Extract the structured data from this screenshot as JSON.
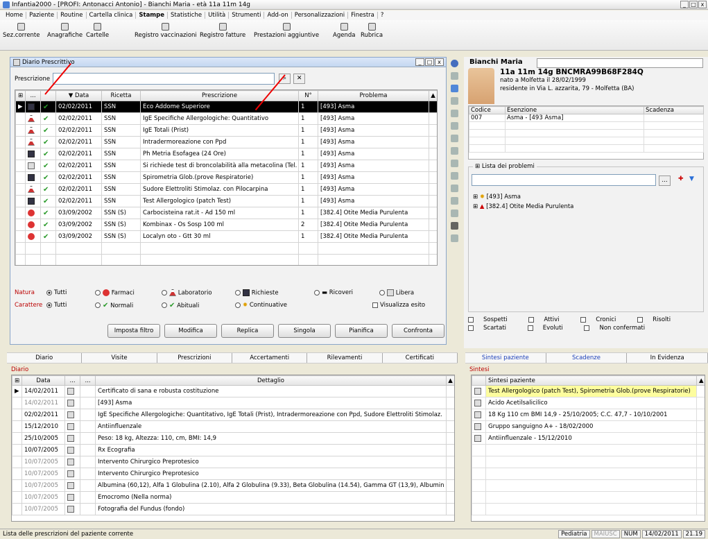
{
  "window": {
    "title": "Infantia2000 - [PROFI: Antonacci Antonio] - Bianchi Maria - età 11a 11m 14g"
  },
  "menu": [
    "Home",
    "Paziente",
    "Routine",
    "Cartella clinica",
    "Stampe",
    "Statistiche",
    "Utilità",
    "Strumenti",
    "Add-on",
    "Personalizzazioni",
    "Finestra",
    "?"
  ],
  "toolbar": [
    "Sez.corrente",
    "Anagrafiche",
    "Cartelle",
    "Registro vaccinazioni",
    "Registro fatture",
    "Prestazioni aggiuntive",
    "Agenda",
    "Rubrica"
  ],
  "dp": {
    "title": "Diario Prescrittivo",
    "presc_label": "Prescrizione",
    "headers": [
      "...",
      "Data",
      "Ricetta",
      "Prescrizione",
      "N°",
      "Problema"
    ],
    "rows": [
      {
        "type": "mon",
        "date": "02/02/2011",
        "ricetta": "SSN",
        "presc": "Eco Addome Superiore",
        "n": "1",
        "prob": "[493] Asma"
      },
      {
        "type": "flask",
        "date": "02/02/2011",
        "ricetta": "SSN",
        "presc": "IgE Specifiche Allergologiche: Quantitativo",
        "n": "1",
        "prob": "[493] Asma"
      },
      {
        "type": "flask",
        "date": "02/02/2011",
        "ricetta": "SSN",
        "presc": "IgE Totali (Prist)",
        "n": "1",
        "prob": "[493] Asma"
      },
      {
        "type": "flask",
        "date": "02/02/2011",
        "ricetta": "SSN",
        "presc": "Intradermoreazione con Ppd",
        "n": "1",
        "prob": "[493] Asma"
      },
      {
        "type": "mon",
        "date": "02/02/2011",
        "ricetta": "SSN",
        "presc": "Ph Metria Esofagea (24 Ore)",
        "n": "1",
        "prob": "[493] Asma"
      },
      {
        "type": "doc",
        "date": "02/02/2011",
        "ricetta": "SSN",
        "presc": "Si richiede test di broncolabilità alla metacolina (Tel.",
        "n": "1",
        "prob": "[493] Asma"
      },
      {
        "type": "mon",
        "date": "02/02/2011",
        "ricetta": "SSN",
        "presc": "Spirometria Glob.(prove Respiratorie)",
        "n": "1",
        "prob": "[493] Asma"
      },
      {
        "type": "flask",
        "date": "02/02/2011",
        "ricetta": "SSN",
        "presc": "Sudore Elettroliti Stimolaz. con Pilocarpina",
        "n": "1",
        "prob": "[493] Asma"
      },
      {
        "type": "mon",
        "date": "02/02/2011",
        "ricetta": "SSN",
        "presc": "Test Allergologico (patch Test)",
        "n": "1",
        "prob": "[493] Asma"
      },
      {
        "type": "pill",
        "date": "03/09/2002",
        "ricetta": "SSN (S)",
        "presc": "Carbocisteina rat.it - Ad 150 ml",
        "n": "1",
        "prob": "[382.4] Otite Media Purulenta"
      },
      {
        "type": "pill",
        "date": "03/09/2002",
        "ricetta": "SSN (S)",
        "presc": "Kombinax - Os Sosp 100 ml",
        "n": "2",
        "prob": "[382.4] Otite Media Purulenta"
      },
      {
        "type": "pill",
        "date": "03/09/2002",
        "ricetta": "SSN (S)",
        "presc": "Localyn oto - Gtt 30 ml",
        "n": "1",
        "prob": "[382.4] Otite Media Purulenta"
      }
    ],
    "natura_label": "Natura",
    "natura": [
      "Tutti",
      "Farmaci",
      "Laboratorio",
      "Richieste",
      "Ricoveri",
      "Libera"
    ],
    "carattere_label": "Carattere",
    "carattere": [
      "Tutti",
      "Normali",
      "Abituali",
      "Continuative"
    ],
    "visualizza": "Visualizza esito",
    "buttons": [
      "Imposta filtro",
      "Modifica",
      "Replica",
      "Singola",
      "Pianifica",
      "Confronta"
    ]
  },
  "patient": {
    "name": "Bianchi Maria",
    "line1": "11a 11m 14g  BNCMRA99B68F284Q",
    "line2": "nato a Molfetta il 28/02/1999",
    "line3": "residente in Via L. azzarita, 79 - Molfetta (BA)",
    "esenzione_headers": [
      "Codice",
      "Esenzione",
      "Scadenza"
    ],
    "esenzione": [
      {
        "codice": "007",
        "esenzione": "Asma - [493 Asma]",
        "scadenza": ""
      }
    ],
    "problems_title": "Lista dei problemi",
    "problems": [
      "[493] Asma",
      "[382.4] Otite Media Purulenta"
    ],
    "legend": [
      "Sospetti",
      "Attivi",
      "Cronici",
      "Risolti",
      "Scartati",
      "Evoluti",
      "Non confermati"
    ]
  },
  "tabs_left": [
    "Diario",
    "Visite",
    "Prescrizioni",
    "Accertamenti",
    "Rilevamenti",
    "Certificati"
  ],
  "tabs_right": [
    "Sintesi paziente",
    "Scadenze",
    "In Evidenza"
  ],
  "diario": {
    "label": "Diario",
    "headers": [
      "Data",
      "...",
      "...",
      "Dettaglio"
    ],
    "rows": [
      {
        "date": "14/02/2011",
        "dim": false,
        "text": "Certificato di sana e robusta costituzione"
      },
      {
        "date": "14/02/2011",
        "dim": true,
        "text": "[493] Asma"
      },
      {
        "date": "02/02/2011",
        "dim": false,
        "text": "IgE Specifiche Allergologiche: Quantitativo, IgE Totali (Prist), Intradermoreazione con Ppd, Sudore Elettroliti Stimolaz."
      },
      {
        "date": "15/12/2010",
        "dim": false,
        "text": "Antiinfluenzale"
      },
      {
        "date": "25/10/2005",
        "dim": false,
        "text": "Peso: 18 kg, Altezza: 110, cm, BMI: 14,9"
      },
      {
        "date": "10/07/2005",
        "dim": false,
        "text": "Rx Ecografia"
      },
      {
        "date": "10/07/2005",
        "dim": true,
        "text": "Intervento Chirurgico Preprotesico"
      },
      {
        "date": "10/07/2005",
        "dim": true,
        "text": "Intervento Chirurgico Preprotesico"
      },
      {
        "date": "10/07/2005",
        "dim": true,
        "text": "Albumina (60,12), Alfa 1 Globulina (2.10), Alfa 2 Globulina (9.33), Beta Globulina (14.54), Gamma GT (13,9), Albumin"
      },
      {
        "date": "10/07/2005",
        "dim": true,
        "text": "Emocromo (Nella norma)"
      },
      {
        "date": "10/07/2005",
        "dim": true,
        "text": "Fotografia del Fundus (fondo)"
      }
    ]
  },
  "sintesi": {
    "label": "Sintesi",
    "header": "Sintesi paziente",
    "rows": [
      "Test Allergologico (patch Test), Spirometria Glob.(prove Respiratorie)",
      "Acido Acetilsalicilico",
      "18 Kg 110 cm BMI 14,9 - 25/10/2005; C.C. 47,7 - 10/10/2001",
      "Gruppo sanguigno A+ - 18/02/2000",
      "Antiinfluenzale - 15/12/2010"
    ]
  },
  "status": {
    "text": "Lista delle prescrizioni del paziente corrente",
    "fields": [
      "Pediatria",
      "MAIUSC",
      "NUM",
      "14/02/2011",
      "21.19"
    ]
  }
}
